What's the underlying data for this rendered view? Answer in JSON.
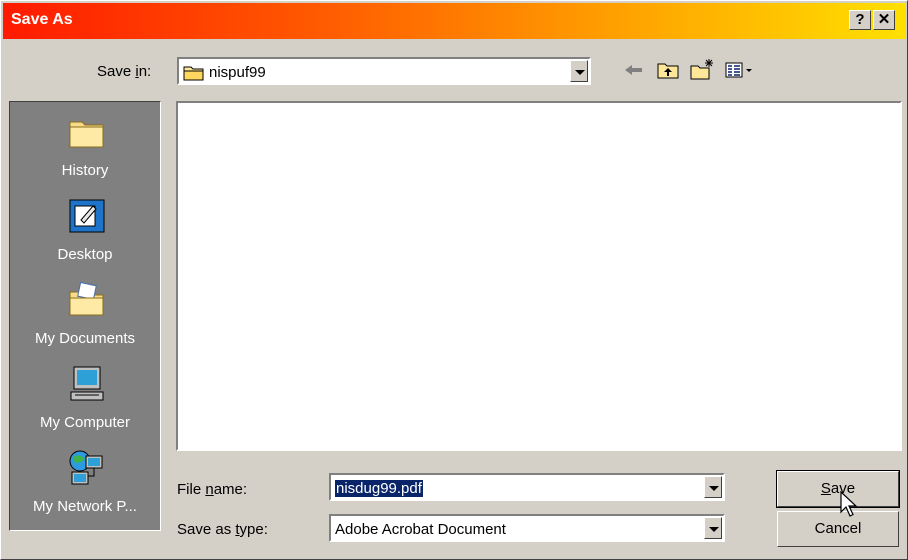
{
  "window": {
    "title": "Save As",
    "help_label": "?",
    "close_label": "✕"
  },
  "save_in": {
    "label_pre": "Save ",
    "label_accel": "i",
    "label_post": "n:",
    "value": "nispuf99"
  },
  "places": [
    {
      "label": "History",
      "icon": "history-folder-icon"
    },
    {
      "label": "Desktop",
      "icon": "desktop-icon"
    },
    {
      "label": "My Documents",
      "icon": "my-documents-icon"
    },
    {
      "label": "My Computer",
      "icon": "my-computer-icon"
    },
    {
      "label": "My Network P...",
      "icon": "my-network-places-icon"
    }
  ],
  "file_name": {
    "label_pre": "File ",
    "label_accel": "n",
    "label_post": "ame:",
    "value": "nisdug99.pdf"
  },
  "save_as_type": {
    "label_pre": "Save as ",
    "label_accel": "t",
    "label_post": "ype:",
    "value": "Adobe Acrobat Document"
  },
  "buttons": {
    "save_accel": "S",
    "save_rest": "ave",
    "cancel": "Cancel"
  },
  "colors": {
    "title_gradient_start": "#ff1a00",
    "title_gradient_end": "#ffe000",
    "selection": "#0a246a"
  }
}
